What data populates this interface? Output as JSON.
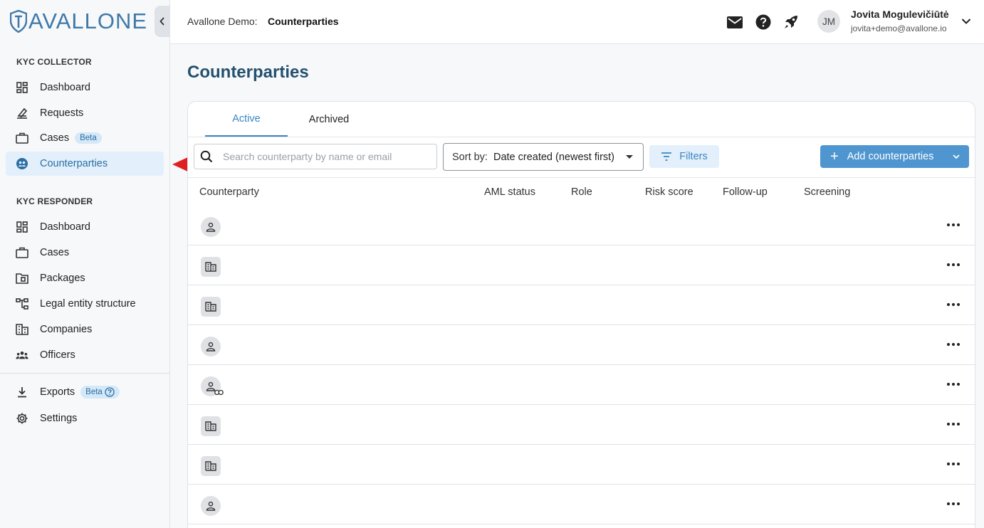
{
  "brand": {
    "logo_text": "AVALLONE",
    "accent": "#3f79a8"
  },
  "sidebar": {
    "collapse_icon": "chevron-left-icon",
    "kyc_collector": {
      "title": "KYC COLLECTOR",
      "items": [
        {
          "label": "Dashboard",
          "icon": "dashboard-icon"
        },
        {
          "label": "Requests",
          "icon": "requests-icon"
        },
        {
          "label": "Cases",
          "icon": "briefcase-icon",
          "badge": "Beta"
        },
        {
          "label": "Counterparties",
          "icon": "counterparties-icon",
          "active": true
        }
      ]
    },
    "kyc_responder": {
      "title": "KYC RESPONDER",
      "items": [
        {
          "label": "Dashboard",
          "icon": "dashboard-icon"
        },
        {
          "label": "Cases",
          "icon": "briefcase-icon"
        },
        {
          "label": "Packages",
          "icon": "packages-icon"
        },
        {
          "label": "Legal entity structure",
          "icon": "structure-icon"
        },
        {
          "label": "Companies",
          "icon": "companies-icon"
        },
        {
          "label": "Officers",
          "icon": "officers-icon"
        }
      ]
    },
    "bottom": {
      "items": [
        {
          "label": "Exports",
          "icon": "download-icon",
          "badge": "Beta",
          "badge_icon": "help-icon"
        },
        {
          "label": "Settings",
          "icon": "gear-icon"
        }
      ]
    }
  },
  "header": {
    "breadcrumb_prefix": "Avallone Demo:",
    "breadcrumb_current": "Counterparties",
    "icons": [
      "mail-icon",
      "help-icon",
      "rocket-icon"
    ],
    "user": {
      "initials": "JM",
      "name": "Jovita Mogulevičiūtė",
      "email": "jovita+demo@avallone.io"
    }
  },
  "main": {
    "title": "Counterparties",
    "tabs": [
      {
        "label": "Active",
        "active": true
      },
      {
        "label": "Archived",
        "active": false
      }
    ],
    "search": {
      "placeholder": "Search counterparty by name or email",
      "value": ""
    },
    "sort": {
      "label": "Sort by:",
      "value": "Date created (newest first)"
    },
    "filters_label": "Filters",
    "add_label": "Add counterparties",
    "columns": [
      "Counterparty",
      "AML status",
      "Role",
      "Risk score",
      "Follow-up",
      "Screening"
    ],
    "rows": [
      {
        "type": "person"
      },
      {
        "type": "company"
      },
      {
        "type": "company"
      },
      {
        "type": "person"
      },
      {
        "type": "person-linked"
      },
      {
        "type": "company"
      },
      {
        "type": "company"
      },
      {
        "type": "person"
      }
    ]
  },
  "colors": {
    "active_tab": "#3b86c4",
    "primary_button": "#4f95cf",
    "title": "#24516f",
    "annotation_arrow": "#e02020"
  }
}
